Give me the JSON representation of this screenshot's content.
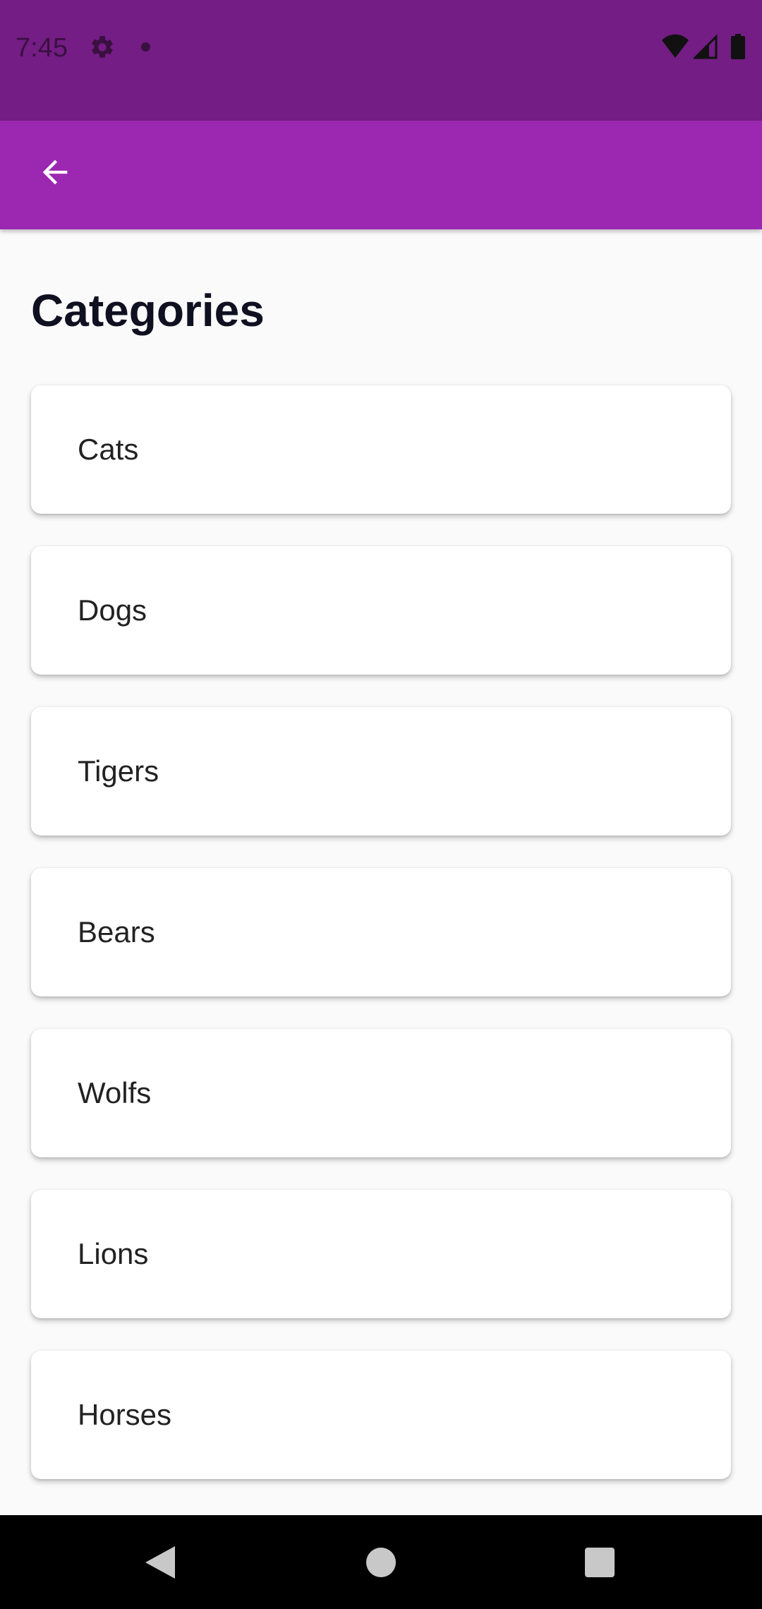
{
  "status_bar": {
    "time": "7:45",
    "icons": [
      "gear-icon",
      "notification-dot-icon",
      "wifi-icon",
      "cell-signal-icon",
      "battery-icon"
    ]
  },
  "app_bar": {
    "back_icon": "arrow-back-icon"
  },
  "page": {
    "title": "Categories"
  },
  "categories": [
    {
      "label": "Cats"
    },
    {
      "label": "Dogs"
    },
    {
      "label": "Tigers"
    },
    {
      "label": "Bears"
    },
    {
      "label": "Wolfs"
    },
    {
      "label": "Lions"
    },
    {
      "label": "Horses"
    }
  ],
  "nav_bar": {
    "icons": [
      "nav-back-icon",
      "nav-home-icon",
      "nav-recents-icon"
    ]
  },
  "colors": {
    "status_bar": "#741d85",
    "app_bar": "#9c27b0",
    "background": "#fafafa",
    "card": "#ffffff",
    "title_text": "#0f1020"
  }
}
